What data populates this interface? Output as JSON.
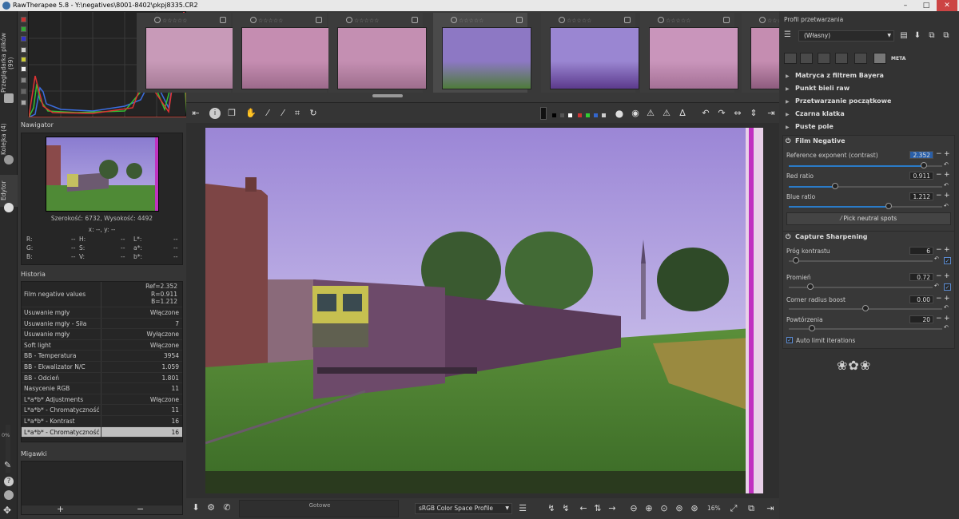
{
  "window": {
    "title": "RawTherapee 5.8 - Y:\\negatives\\8001-8402\\pkpj8335.CR2"
  },
  "vtabs": {
    "browser": "Przeglądarka plików (99)",
    "queue": "Kolejka (4)",
    "editor": "Edytor"
  },
  "left": {
    "zoom_pct": "0%",
    "navigator": {
      "title": "Nawigator",
      "size": "Szerokość: 6732, Wysokość: 4492",
      "coords": "x: --, y: --",
      "rows": [
        {
          "a": "R:",
          "av": "--",
          "b": "H:",
          "bv": "--",
          "c": "L*:",
          "cv": "--"
        },
        {
          "a": "G:",
          "av": "--",
          "b": "S:",
          "bv": "--",
          "c": "a*:",
          "cv": "--"
        },
        {
          "a": "B:",
          "av": "--",
          "b": "V:",
          "bv": "--",
          "c": "b*:",
          "cv": "--"
        }
      ]
    },
    "history": {
      "title": "Historia",
      "first": {
        "k": "Film negative values",
        "v1": "Ref=2.352",
        "v2": "R=0.911",
        "v3": "B=1.212"
      },
      "rows": [
        {
          "k": "Usuwanie mgły",
          "v": "Włączone"
        },
        {
          "k": "Usuwanie mgły - Siła",
          "v": "7"
        },
        {
          "k": "Usuwanie mgły",
          "v": "Wyłączone"
        },
        {
          "k": "Soft light",
          "v": "Włączone"
        },
        {
          "k": "BB - Temperatura",
          "v": "3954"
        },
        {
          "k": "BB - Ekwalizator N/C",
          "v": "1.059"
        },
        {
          "k": "BB - Odcień",
          "v": "1.801"
        },
        {
          "k": "Nasycenie RGB",
          "v": "11"
        },
        {
          "k": "L*a*b* Adjustments",
          "v": "Włączone"
        },
        {
          "k": "L*a*b* - Chromatyczność",
          "v": "11"
        },
        {
          "k": "L*a*b* - Kontrast",
          "v": "16"
        },
        {
          "k": "L*a*b* - Chromatyczność",
          "v": "16"
        }
      ]
    },
    "snapshots": {
      "title": "Migawki",
      "add": "+",
      "remove": "−"
    }
  },
  "filmstrip": {
    "thumbs": [
      {
        "stars": "☆☆☆☆☆",
        "colorA": "#c89ab8",
        "colorB": "#a57a96"
      },
      {
        "stars": "☆☆☆☆☆",
        "colorA": "#c58db1",
        "colorB": "#9c6a8b"
      },
      {
        "stars": "☆☆☆☆☆",
        "colorA": "#c48fb2",
        "colorB": "#9e6e8d"
      },
      {
        "stars": "☆☆☆☆☆",
        "colorA": "#8d78c4",
        "colorB": "#4e7b3a"
      },
      {
        "stars": "☆☆☆☆☆",
        "colorA": "#9a86d2",
        "colorB": "#5c3a8c"
      },
      {
        "stars": "☆☆☆☆☆",
        "colorA": "#c995bb",
        "colorB": "#a47095"
      },
      {
        "stars": "☆☆☆☆☆",
        "colorA": "#c58db1",
        "colorB": "#8e5c7e"
      }
    ]
  },
  "bottom": {
    "status": "Gotowe",
    "profile": "sRGB Color Space Profile",
    "zoom": "16%"
  },
  "right": {
    "profile_title": "Profil przetwarzania",
    "profile_value": "(Własny)",
    "sections": [
      "Matryca z filtrem Bayera",
      "Punkt bieli raw",
      "Przetwarzanie początkowe",
      "Czarna klatka",
      "Puste pole"
    ],
    "film_negative": {
      "title": "Film Negative",
      "ref_label": "Reference exponent (contrast)",
      "ref_value": "2.352",
      "red_label": "Red ratio",
      "red_value": "0.911",
      "blue_label": "Blue ratio",
      "blue_value": "1.212",
      "pick_label": "Pick neutral spots"
    },
    "capture": {
      "title": "Capture Sharpening",
      "contrast_label": "Próg kontrastu",
      "contrast_value": "6",
      "radius_label": "Promień",
      "radius_value": "0.72",
      "corner_label": "Corner radius boost",
      "corner_value": "0.00",
      "iter_label": "Powtórzenia",
      "iter_value": "20",
      "auto_label": "Auto limit iterations"
    },
    "meta_label": "META"
  },
  "levels": {
    "ref": 0.88,
    "red": 0.3,
    "blue": 0.65,
    "contrast": 0.05,
    "radius": 0.15,
    "corner": 0.5,
    "iter": 0.15
  },
  "colors": {
    "accent": "#2a7bc8",
    "panel": "#353535"
  }
}
